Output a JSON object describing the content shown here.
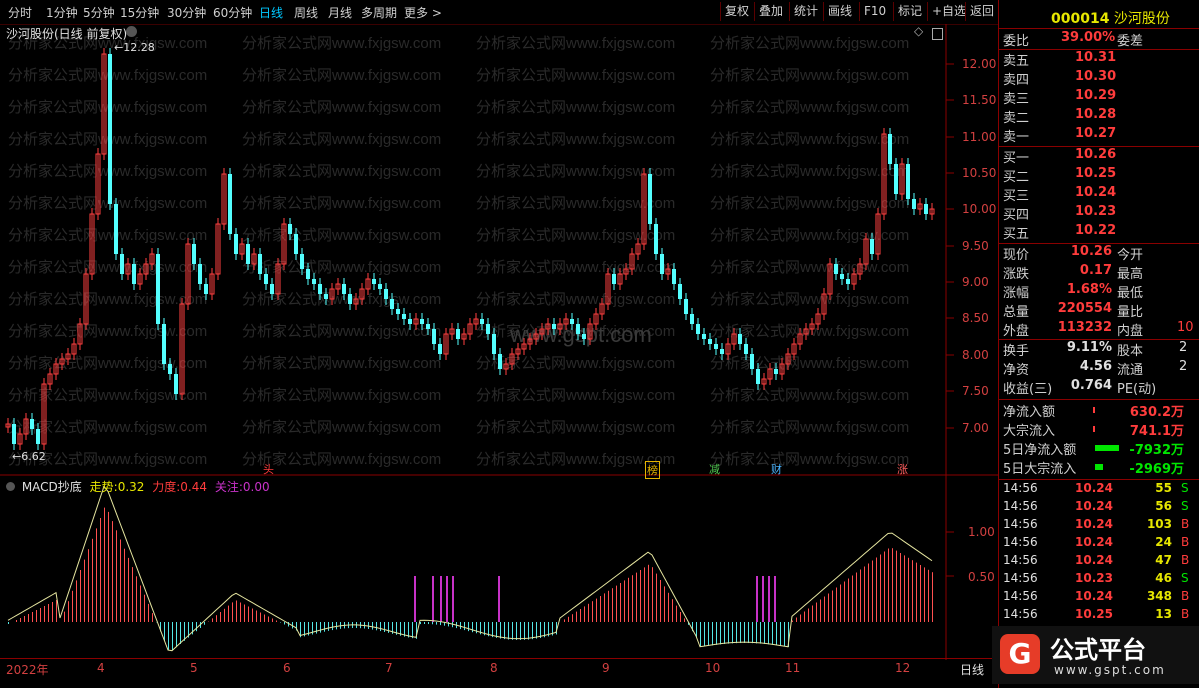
{
  "toolbar": {
    "periods": [
      "分时",
      "1分钟",
      "5分钟",
      "15分钟",
      "30分钟",
      "60分钟",
      "日线",
      "周线",
      "月线",
      "多周期",
      "更多 >"
    ],
    "active_period": "日线",
    "buttons": [
      "复权",
      "叠加",
      "统计",
      "画线",
      "F10",
      "标记",
      "+自选",
      "返回"
    ]
  },
  "chart_title": "沙河股份(日线 前复权)",
  "watermark": "分析家公式网www.fxjgsw.com",
  "watermark_center": "www.gspt.com",
  "price_axis": [
    "12.00",
    "11.50",
    "11.00",
    "10.50",
    "10.00",
    "9.50",
    "9.00",
    "8.50",
    "8.00",
    "7.50",
    "7.00"
  ],
  "high_label": "12.28",
  "low_label": "6.62",
  "annotations": [
    {
      "text": "头",
      "color": "#ff3c3c"
    },
    {
      "text": "榜",
      "color": "#e6b400"
    },
    {
      "text": "减",
      "color": "#50c850"
    },
    {
      "text": "财",
      "color": "#4ab4ff"
    },
    {
      "text": "涨",
      "color": "#ff6060"
    }
  ],
  "macd": {
    "name": "MACD抄底",
    "items": [
      {
        "label": "走势:",
        "value": "0.32",
        "color": "#e6e600"
      },
      {
        "label": "力度:",
        "value": "0.44",
        "color": "#ff3c3c"
      },
      {
        "label": "关注:",
        "value": "0.00",
        "color": "#c832c8"
      }
    ],
    "axis": [
      "1.00",
      "0.50"
    ]
  },
  "date_axis": [
    "2022年",
    "4",
    "5",
    "6",
    "7",
    "8",
    "9",
    "10",
    "11",
    "12"
  ],
  "date_axis_right": "日线",
  "right": {
    "code": "000014",
    "name": "沙河股份",
    "weibi_label": "委比",
    "weibi_value": "39.00%",
    "weicha_label": "委差",
    "asks": [
      {
        "label": "卖五",
        "price": "10.31"
      },
      {
        "label": "卖四",
        "price": "10.30"
      },
      {
        "label": "卖三",
        "price": "10.29"
      },
      {
        "label": "卖二",
        "price": "10.28"
      },
      {
        "label": "卖一",
        "price": "10.27"
      }
    ],
    "bids": [
      {
        "label": "买一",
        "price": "10.26"
      },
      {
        "label": "买二",
        "price": "10.25"
      },
      {
        "label": "买三",
        "price": "10.24"
      },
      {
        "label": "买四",
        "price": "10.23"
      },
      {
        "label": "买五",
        "price": "10.22"
      }
    ],
    "quote": [
      {
        "l1": "现价",
        "v1": "10.26",
        "l2": "今开"
      },
      {
        "l1": "涨跌",
        "v1": "0.17",
        "l2": "最高"
      },
      {
        "l1": "涨幅",
        "v1": "1.68%",
        "l2": "最低"
      },
      {
        "l1": "总量",
        "v1": "220554",
        "l2": "量比"
      },
      {
        "l1": "外盘",
        "v1": "113232",
        "l2": "内盘",
        "v2": "10"
      }
    ],
    "stats": [
      {
        "l1": "换手",
        "v1": "9.11%",
        "l2": "股本",
        "v2": "2"
      },
      {
        "l1": "净资",
        "v1": "4.56",
        "l2": "流通",
        "v2": "2"
      },
      {
        "l1": "收益(三)",
        "v1": "0.764",
        "l2": "PE(动)",
        "v2": ""
      }
    ],
    "flows": [
      {
        "label": "净流入额",
        "value": "630.2万",
        "color": "#ff3c3c"
      },
      {
        "label": "大宗流入",
        "value": "741.1万",
        "color": "#ff3c3c"
      },
      {
        "label": "5日净流入额",
        "value": "-7932万",
        "color": "#00e600"
      },
      {
        "label": "5日大宗流入",
        "value": "-2969万",
        "color": "#00e600"
      }
    ],
    "ticks": [
      {
        "time": "14:56",
        "price": "10.24",
        "vol": "55",
        "side": "S"
      },
      {
        "time": "14:56",
        "price": "10.24",
        "vol": "56",
        "side": "S"
      },
      {
        "time": "14:56",
        "price": "10.24",
        "vol": "103",
        "side": "B"
      },
      {
        "time": "14:56",
        "price": "10.24",
        "vol": "24",
        "side": "B"
      },
      {
        "time": "14:56",
        "price": "10.24",
        "vol": "47",
        "side": "B"
      },
      {
        "time": "14:56",
        "price": "10.23",
        "vol": "46",
        "side": "S"
      },
      {
        "time": "14:56",
        "price": "10.24",
        "vol": "348",
        "side": "B"
      },
      {
        "time": "14:56",
        "price": "10.25",
        "vol": "13",
        "side": "B"
      },
      {
        "time": "14:56",
        "price": "",
        "vol": "",
        "side": ""
      }
    ]
  },
  "logo": {
    "text": "公式平台",
    "url": "www.gspt.com"
  }
}
